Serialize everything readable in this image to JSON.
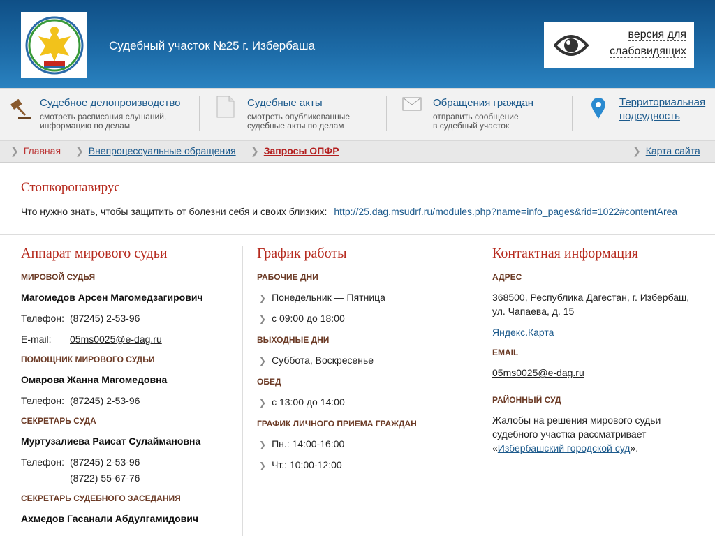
{
  "header": {
    "site_title": "Судебный участок №25 г. Избербаша",
    "vision_line1": "версия для",
    "vision_line2": "слабовидящих"
  },
  "nav": [
    {
      "title": "Судебное делопроизводство",
      "desc1": "смотреть расписания слушаний,",
      "desc2": "информацию по делам",
      "icon": "gavel-icon"
    },
    {
      "title": "Судебные акты",
      "desc1": "смотреть опубликованные",
      "desc2": "судебные акты по делам",
      "icon": "document-icon"
    },
    {
      "title": "Обращения граждан",
      "desc1": "отправить сообщение",
      "desc2": "в судебный участок",
      "icon": "envelope-icon"
    },
    {
      "title1": "Территориальная",
      "title2": "подсудность",
      "icon": "map-pin-icon"
    }
  ],
  "breadcrumbs": {
    "home": "Главная",
    "section": "Внепроцессуальные обращения",
    "current": "Запросы ОПФР",
    "sitemap": "Карта сайта"
  },
  "notice": {
    "title": "Стопкоронавирус",
    "text": "Что нужно знать, чтобы защитить от болезни себя и своих близких:",
    "link": " http://25.dag.msudrf.ru/modules.php?name=info_pages&rid=1022#contentArea"
  },
  "staff": {
    "title": "Аппарат мирового судьи",
    "judge_label": "Мировой судья",
    "judge_name": "Магомедов Арсен Магомедзагирович",
    "phone_label": "Телефон:",
    "judge_phone": "(87245) 2-53-96",
    "email_label": "E-mail:",
    "judge_email": "05ms0025@e-dag.ru",
    "assistant_label": "Помощник мирового судьи",
    "assistant_name": "Омарова Жанна Магомедовна",
    "assistant_phone": "(87245) 2-53-96",
    "secretary_label": "Секретарь суда",
    "secretary_name": "Муртузалиева Раисат Сулаймановна",
    "secretary_phone1": "(87245) 2-53-96",
    "secretary_phone2": "(8722) 55-67-76",
    "session_label": "Секретарь судебного заседания",
    "session_name": "Ахмедов Гасанали Абдулгамидович"
  },
  "schedule": {
    "title": "График работы",
    "workdays_label": "Рабочие дни",
    "workdays": "Понедельник — Пятница",
    "work_hours": "с 09:00 до 18:00",
    "weekend_label": "Выходные дни",
    "weekend": "Суббота, Воскресенье",
    "lunch_label": "Обед",
    "lunch": "с 13:00 до 14:00",
    "reception_label": "График личного приема граждан",
    "reception1": "Пн.: 14:00-16:00",
    "reception2": "Чт.: 10:00-12:00"
  },
  "contacts": {
    "title": "Контактная информация",
    "address_label": "Адрес",
    "address1": "368500, Республика Дагестан, г. Избербаш,",
    "address2": "ул. Чапаева, д. 15",
    "map_link": "Яндекс.Карта",
    "email_label": "Email",
    "email": "05ms0025@e-dag.ru",
    "district_label": "Районный суд",
    "district1": "Жалобы на решения мирового судьи",
    "district2": "судебного участка рассматривает",
    "district3_pre": "«",
    "district_link": "Избербашский городской суд",
    "district3_post": "»."
  },
  "colors": {
    "header_blue": "#1d6ca8",
    "accent_red": "#b62a1e",
    "link_blue": "#1c5a8c"
  }
}
